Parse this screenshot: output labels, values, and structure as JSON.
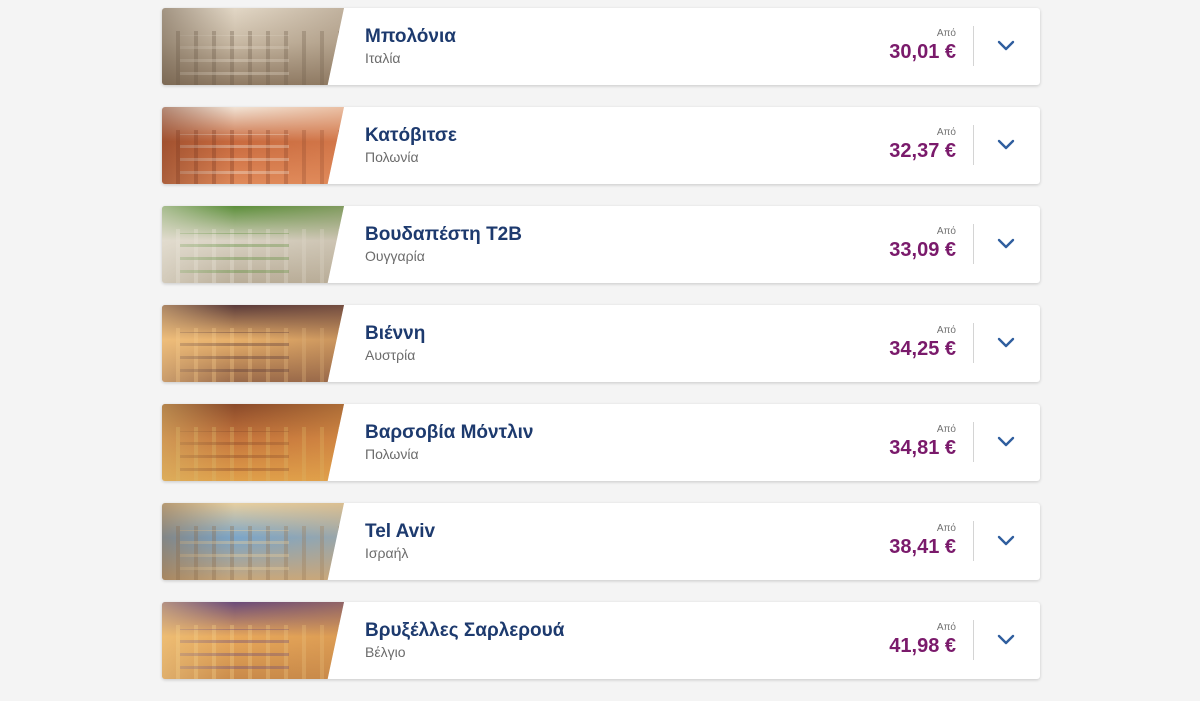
{
  "destinations": [
    {
      "city": "Μπολόνια",
      "country": "Ιταλία",
      "from_label": "Από",
      "price": "30,01 €",
      "thumb_colors": [
        "#c8b9a4",
        "#8f7a63",
        "#e2d7c6",
        "#6b5a48"
      ]
    },
    {
      "city": "Κατόβιτσε",
      "country": "Πολωνία",
      "from_label": "Από",
      "price": "32,37 €",
      "thumb_colors": [
        "#c96a3e",
        "#e08a5a",
        "#f1e3d5",
        "#7d3a22"
      ]
    },
    {
      "city": "Βουδαπέστη T2B",
      "country": "Ουγγαρία",
      "from_label": "Από",
      "price": "33,09 €",
      "thumb_colors": [
        "#d9d2c3",
        "#b9ad98",
        "#5c8f3a",
        "#e9e4d8"
      ]
    },
    {
      "city": "Βιέννη",
      "country": "Αυστρία",
      "from_label": "Από",
      "price": "34,25 €",
      "thumb_colors": [
        "#e8b06a",
        "#9a6a4a",
        "#5a3a3a",
        "#f3c98a"
      ]
    },
    {
      "city": "Βαρσοβία Μόντλιν",
      "country": "Πολωνία",
      "from_label": "Από",
      "price": "34,81 €",
      "thumb_colors": [
        "#c5743c",
        "#e0a04a",
        "#8a4a2a",
        "#d9b86a"
      ]
    },
    {
      "city": "Tel Aviv",
      "country": "Ισραήλ",
      "from_label": "Από",
      "price": "38,41 €",
      "thumb_colors": [
        "#7aa5c9",
        "#c9a77a",
        "#e7cfa0",
        "#8a6a4a"
      ]
    },
    {
      "city": "Βρυξέλλες Σαρλερουά",
      "country": "Βέλγιο",
      "from_label": "Από",
      "price": "41,98 €",
      "thumb_colors": [
        "#e8a85a",
        "#c98a4a",
        "#6a4a7a",
        "#f2cf8a"
      ]
    }
  ],
  "colors": {
    "city": "#1d3a6e",
    "price": "#7a1a6b",
    "chevron": "#2f5e9e"
  },
  "icons": {
    "expand": "chevron-down-icon"
  }
}
